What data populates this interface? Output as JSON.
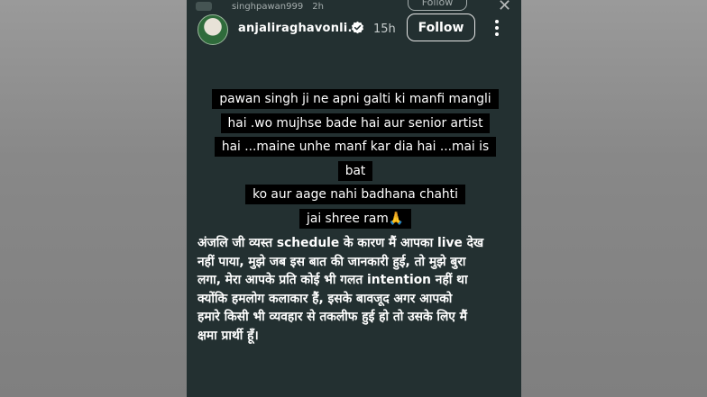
{
  "peek": {
    "username": "singhpawan999",
    "time": "2h",
    "follow_label": "Follow",
    "close_icon": "close-icon"
  },
  "header": {
    "username": "anjaliraghavonli...",
    "time": "15h",
    "follow_label": "Follow",
    "icons": [
      "avatar",
      "verified-badge-icon",
      "more-options-icon"
    ]
  },
  "quote": {
    "lines": [
      "pawan singh ji ne apni galti ki manfi mangli",
      "hai .wo mujhse bade hai aur senior artist",
      "hai ...maine unhe manf kar dia hai ...mai is bat",
      "ko aur aage nahi badhana chahti",
      "jai shree ram🙏"
    ]
  },
  "body_text": "अंजलि जी व्यस्त schedule के कारण मैं आपका live देख\nनहीं पाया,  मुझे जब इस बात की जानकारी हुई,  तो मुझे बुरा\nलगा,  मेरा आपके प्रति कोई भी गलत intention नहीं था\nक्योंकि हमलोग कलाकार हैं,  इसके बावजूद अगर आपको\nहमारे  किसी भी व्यवहार से तकलीफ हुई हो तो उसके लिए मैं\nक्षमा प्रार्थी हूँ।",
  "colors": {
    "story_bg": "#233031",
    "side_bg": "#8c8c8c",
    "verified_blue": "#3897f0"
  }
}
